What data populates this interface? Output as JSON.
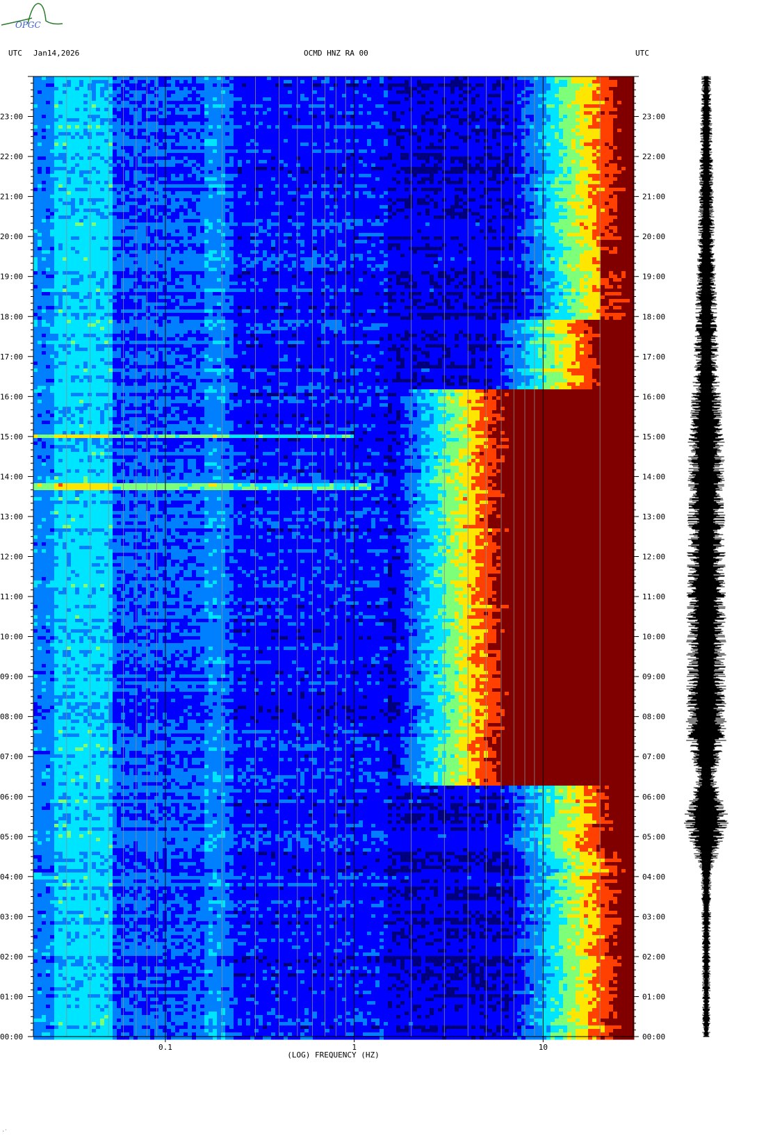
{
  "header": {
    "left_label": "UTC",
    "date": "Jan14,2026",
    "station": "OCMD HNZ RA 00",
    "right_label": "UTC"
  },
  "logo": {
    "text": "OPGC",
    "color": "#2a7a2a"
  },
  "footer_mark": "·′",
  "colors": {
    "background": "#ffffff",
    "frame": "#000000",
    "gridline": "#8c8c8c"
  },
  "chart_data": {
    "type": "heatmap",
    "title": "OCMD HNZ RA 00",
    "xlabel": "(LOG) FREQUENCY (HZ)",
    "ylabel": "",
    "xscale": "log",
    "xlim": [
      0.02,
      30
    ],
    "x_ticks": [
      {
        "value": 0.1,
        "label": "0.1"
      },
      {
        "value": 1,
        "label": "1"
      },
      {
        "value": 10,
        "label": "10"
      }
    ],
    "y_ticks_left": [
      "00:00",
      "01:00",
      "02:00",
      "03:00",
      "04:00",
      "05:00",
      "06:00",
      "07:00",
      "08:00",
      "09:00",
      "10:00",
      "11:00",
      "12:00",
      "13:00",
      "14:00",
      "15:00",
      "16:00",
      "17:00",
      "18:00",
      "19:00",
      "20:00",
      "21:00",
      "22:00",
      "23:00"
    ],
    "y_ticks_right": [
      "00:00",
      "01:00",
      "02:00",
      "03:00",
      "04:00",
      "05:00",
      "06:00",
      "07:00",
      "08:00",
      "09:00",
      "10:00",
      "11:00",
      "12:00",
      "13:00",
      "14:00",
      "15:00",
      "16:00",
      "17:00",
      "18:00",
      "19:00",
      "20:00",
      "21:00",
      "22:00",
      "23:00"
    ],
    "ylim_hours": [
      0,
      24
    ],
    "colormap": [
      "#00007f",
      "#0000ff",
      "#0080ff",
      "#00e5ff",
      "#7dff7a",
      "#ffe600",
      "#ff4000",
      "#800000"
    ],
    "noisy_period_hours": [
      6.3,
      16.2
    ],
    "transient_lines": [
      {
        "hour": 13.8,
        "f_max": 1.2
      },
      {
        "hour": 15.05,
        "f_max": 1.0
      }
    ],
    "waveform_amplitude_envelope": [
      {
        "hour": 0,
        "amp": 0.15
      },
      {
        "hour": 4,
        "amp": 0.2
      },
      {
        "hour": 5.4,
        "amp": 0.9
      },
      {
        "hour": 6.5,
        "amp": 0.35
      },
      {
        "hour": 7.5,
        "amp": 0.8
      },
      {
        "hour": 11,
        "amp": 0.75
      },
      {
        "hour": 15,
        "amp": 0.7
      },
      {
        "hour": 16.5,
        "amp": 0.5
      },
      {
        "hour": 18,
        "amp": 0.45
      },
      {
        "hour": 19.5,
        "amp": 0.35
      },
      {
        "hour": 24,
        "amp": 0.18
      }
    ]
  }
}
